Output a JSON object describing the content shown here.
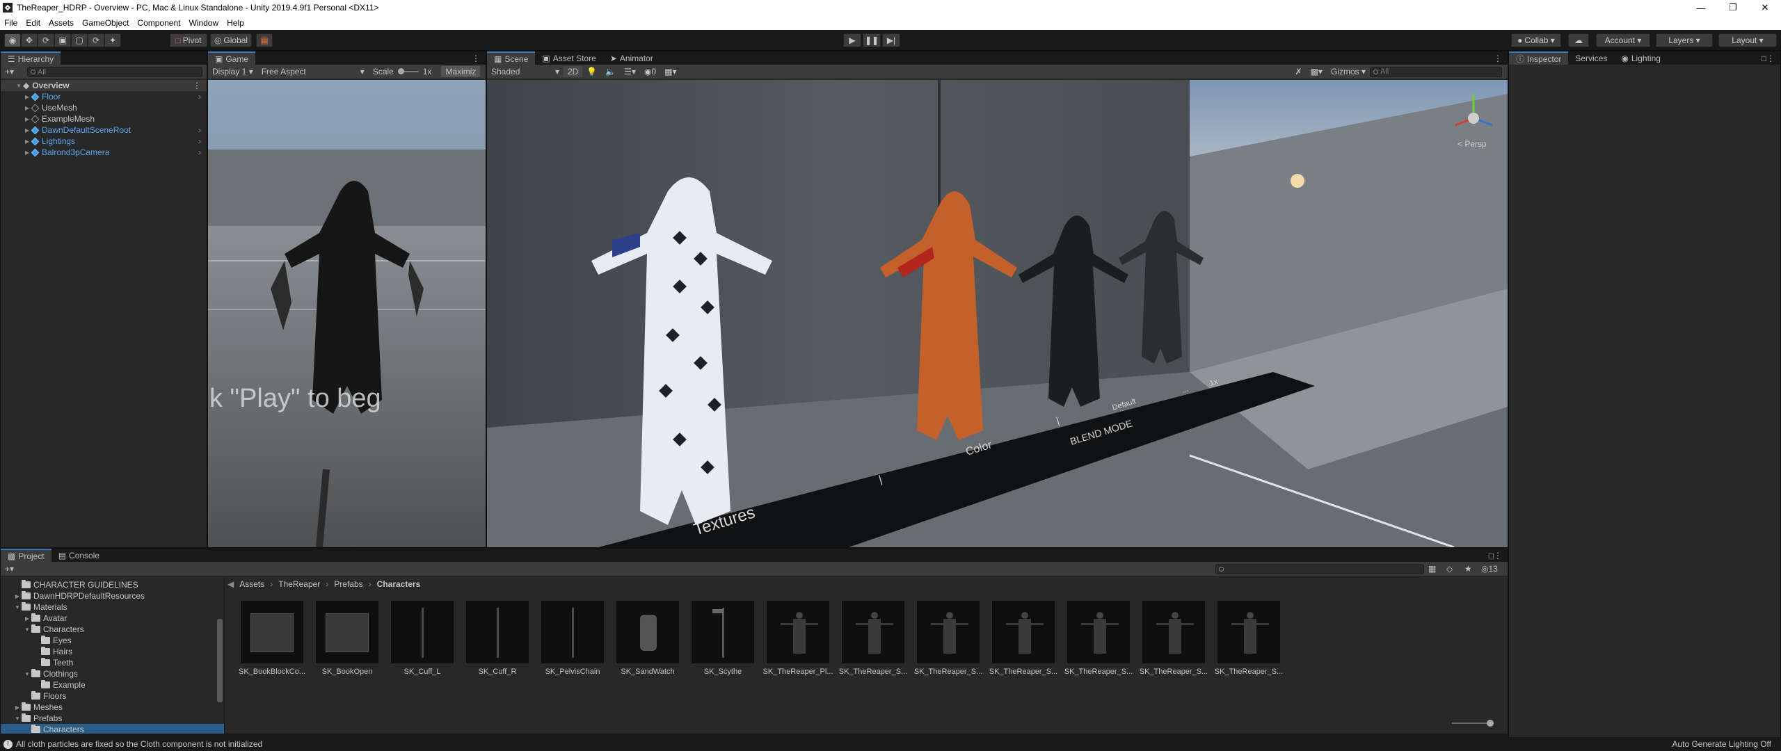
{
  "window": {
    "title": "TheReaper_HDRP - Overview - PC, Mac & Linux Standalone - Unity 2019.4.9f1 Personal <DX11>"
  },
  "menu": [
    "File",
    "Edit",
    "Assets",
    "GameObject",
    "Component",
    "Window",
    "Help"
  ],
  "toolbar": {
    "pivot": "Pivot",
    "global": "Global",
    "collab": "Collab",
    "account": "Account",
    "layers": "Layers",
    "layout": "Layout"
  },
  "hierarchy": {
    "tab": "Hierarchy",
    "search_placeholder": "All",
    "scene": "Overview",
    "items": [
      {
        "label": "Floor",
        "blue": true,
        "chev": true
      },
      {
        "label": "UseMesh",
        "blue": false,
        "chev": false
      },
      {
        "label": "ExampleMesh",
        "blue": false,
        "chev": false
      },
      {
        "label": "DawnDefaultSceneRoot",
        "blue": true,
        "chev": true
      },
      {
        "label": "Lightings",
        "blue": true,
        "chev": true
      },
      {
        "label": "Balrond3pCamera",
        "blue": true,
        "chev": true
      }
    ]
  },
  "game": {
    "tab": "Game",
    "display": "Display 1",
    "aspect": "Free Aspect",
    "scale_label": "Scale",
    "scale_value": "1x",
    "maximize": "Maximiz",
    "overlay": "k \"Play\" to beg"
  },
  "scene": {
    "tabs": [
      "Scene",
      "Asset Store",
      "Animator"
    ],
    "shading": "Shaded",
    "mode2d": "2D",
    "fx_count": "0",
    "gizmos": "Gizmos",
    "search_placeholder": "All",
    "persp": "< Persp",
    "floor_texts": [
      "Textures",
      "|",
      "Color",
      "|",
      "BLEND MODE",
      "Default",
      "...",
      "1x"
    ]
  },
  "inspector": {
    "tabs": [
      "Inspector",
      "Services",
      "Lighting"
    ]
  },
  "project": {
    "tabs": [
      "Project",
      "Console"
    ],
    "tree": [
      {
        "label": "CHARACTER GUIDELINES",
        "depth": 0,
        "open": false,
        "exp": false
      },
      {
        "label": "DawnHDRPDefaultResources",
        "depth": 0,
        "open": false,
        "exp": true
      },
      {
        "label": "Materials",
        "depth": 0,
        "open": true,
        "exp": true
      },
      {
        "label": "Avatar",
        "depth": 1,
        "open": false,
        "exp": true
      },
      {
        "label": "Characters",
        "depth": 1,
        "open": true,
        "exp": true
      },
      {
        "label": "Eyes",
        "depth": 2,
        "open": false,
        "exp": false
      },
      {
        "label": "Hairs",
        "depth": 2,
        "open": false,
        "exp": false
      },
      {
        "label": "Teeth",
        "depth": 2,
        "open": false,
        "exp": false
      },
      {
        "label": "Clothings",
        "depth": 1,
        "open": true,
        "exp": true
      },
      {
        "label": "Example",
        "depth": 2,
        "open": false,
        "exp": false
      },
      {
        "label": "Floors",
        "depth": 1,
        "open": false,
        "exp": false
      },
      {
        "label": "Meshes",
        "depth": 0,
        "open": false,
        "exp": true
      },
      {
        "label": "Prefabs",
        "depth": 0,
        "open": true,
        "exp": true
      },
      {
        "label": "Characters",
        "depth": 1,
        "open": false,
        "exp": false,
        "selected": true
      }
    ],
    "breadcrumb": [
      "Assets",
      "TheReaper",
      "Prefabs",
      "Characters"
    ],
    "hidden_count": "13",
    "assets": [
      "SK_BookBlockCo...",
      "SK_BookOpen",
      "SK_Cuff_L",
      "SK_Cuff_R",
      "SK_PelvisChain",
      "SK_SandWatch",
      "SK_Scythe",
      "SK_TheReaper_Pl...",
      "SK_TheReaper_S...",
      "SK_TheReaper_S...",
      "SK_TheReaper_S...",
      "SK_TheReaper_S...",
      "SK_TheReaper_S...",
      "SK_TheReaper_S..."
    ]
  },
  "status": {
    "message": "All cloth particles are fixed so the Cloth component is not initialized",
    "right": "Auto Generate Lighting Off"
  },
  "colors": {
    "accent": "#3a79bb",
    "panel": "#282828",
    "blue_text": "#5ca6f0"
  }
}
